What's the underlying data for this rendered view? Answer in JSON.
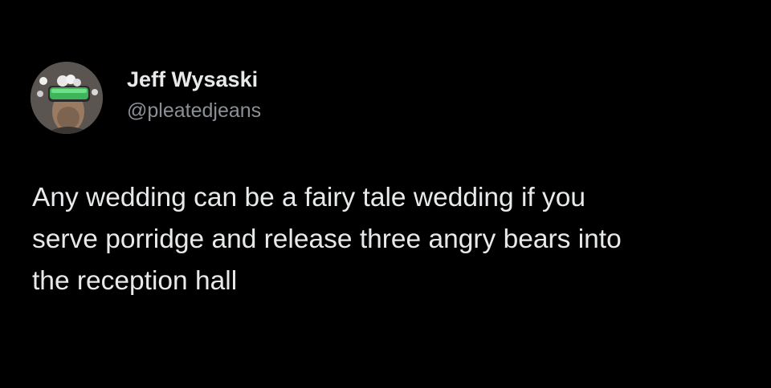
{
  "tweet": {
    "author": {
      "display_name": "Jeff Wysaski",
      "handle": "@pleatedjeans",
      "avatar_icon": "person-with-green-goggles-avatar"
    },
    "text": "Any wedding can be a fairy tale wedding if you\nserve porridge and release three angry bears into\nthe reception hall"
  },
  "colors": {
    "background": "#000000",
    "primary_text": "#e7e9ea",
    "secondary_text": "#8b9096"
  }
}
